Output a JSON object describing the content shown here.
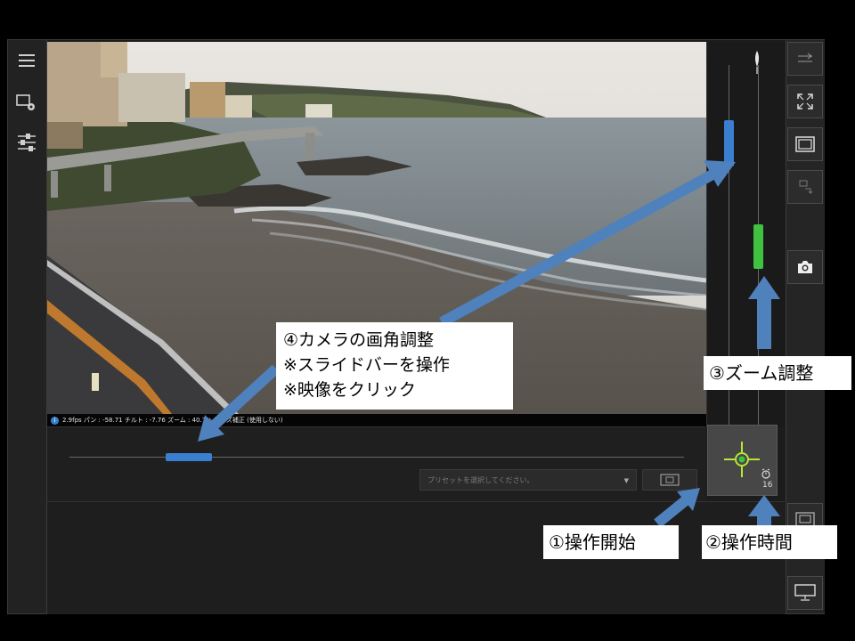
{
  "status_bar": {
    "text": "2.9fps パン : -58.71 チルト : -7.76 ズーム : 40.7%   レンズ補正 (使用しない)"
  },
  "preset": {
    "placeholder": "プリセットを選択してください。"
  },
  "control": {
    "remaining_time": "16"
  },
  "annotations": {
    "angle": {
      "line1": "④カメラの画角調整",
      "line2": "※スライドバーを操作",
      "line3": "※映像をクリック"
    },
    "zoom": "③ズーム調整",
    "start": "①操作開始",
    "time": "②操作時間"
  },
  "colors": {
    "pan_tilt_slider": "#3a7fd0",
    "zoom_slider": "#3fc23f",
    "arrow": "#4f81bd",
    "target_reticle": "#b8e636"
  },
  "icons": {
    "left_toolbar": [
      "menu-icon",
      "camera-settings-icon",
      "adjust-sliders-icon"
    ],
    "right_toolbar": [
      "collapse-icon",
      "fullscreen-icon",
      "fit-view-icon",
      "camera-switch-icon",
      "snapshot-icon",
      "layout-icon",
      "display-settings-icon"
    ]
  }
}
